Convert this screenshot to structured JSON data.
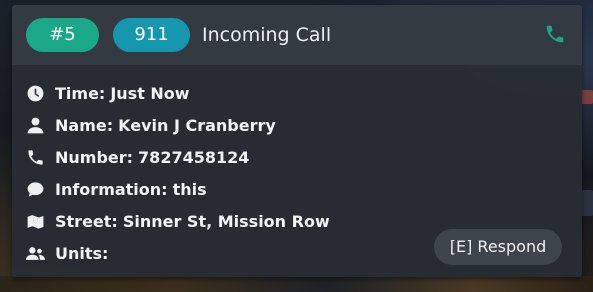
{
  "call": {
    "id_badge": "#5",
    "code_badge": "911",
    "title": "Incoming Call",
    "header_icon": "phone-icon",
    "accent_color": "#1aa889",
    "code_color": "#1697b0"
  },
  "fields": [
    {
      "icon": "clock-icon",
      "label": "Time:",
      "value": "Just Now"
    },
    {
      "icon": "user-icon",
      "label": "Name:",
      "value": "Kevin J Cranberry"
    },
    {
      "icon": "phone-icon",
      "label": "Number:",
      "value": "7827458124"
    },
    {
      "icon": "comment-icon",
      "label": "Information:",
      "value": "this"
    },
    {
      "icon": "map-icon",
      "label": "Street:",
      "value": "Sinner St, Mission Row"
    },
    {
      "icon": "users-icon",
      "label": "Units:",
      "value": ""
    }
  ],
  "actions": {
    "respond_label": "[E] Respond"
  }
}
